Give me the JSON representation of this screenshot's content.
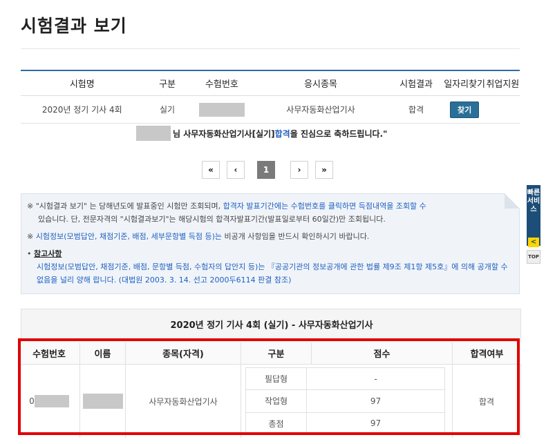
{
  "page": {
    "title": "시험결과 보기"
  },
  "result_table": {
    "headers": [
      "시험명",
      "구분",
      "수험번호",
      "응시종목",
      "시험결과",
      "일자리찾기",
      "취업지원"
    ],
    "row": {
      "exam_name": "2020년 정기 기사 4회",
      "category": "실기",
      "subject": "사무자동화산업기사",
      "result": "합격",
      "find_label": "찾기"
    }
  },
  "congrats": {
    "prefix": "님 사무자동화산업기사[실기] ",
    "highlight": "합격",
    "suffix": "을 진심으로 축하드립니다.\""
  },
  "pager": {
    "first": "«",
    "prev": "‹",
    "current": "1",
    "next": "›",
    "last": "»"
  },
  "notice": {
    "line1_a": "※ \"시험결과 보기\" 는 당해년도에 발표중인 시험만 조회되며, ",
    "line1_b": "합격자 발표기간에는 수험번호를 클릭하면 득점내역을 조회할 수",
    "line1_c": "있습니다. 단, 전문자격의 \"시험결과보기\"는 해당시험의 합격자발표기간(발표일로부터 60일간)만 조회됩니다.",
    "line2_a": "※ ",
    "line2_b": "시험정보(모범답안, 채점기준, 배점, 세부문항별 득점 등)는",
    "line2_c": " 비공개 사항임을 반드시 확인하시기 바랍니다.",
    "ref_title": "참고사항",
    "ref_body": "시험정보(모범답안, 채점기준, 배점, 문항별 득점, 수험자의 답안지 등)는 『공공기관의 정보공개에 관한 법률 제9조 제1항 제5호』에 의해 공개할 수 없음을 널리 양해 랍니다. (대법원 2003. 3. 14. 선고 2000두6114 판결 참조)"
  },
  "quick_menu": {
    "label": "빠른서비스",
    "arrow": "<",
    "top": "TOP"
  },
  "score": {
    "title": "2020년 정기 기사 4회 (실기) - 사무자동화산업기사",
    "headers": [
      "수험번호",
      "이름",
      "종목(자격)",
      "구분",
      "점수",
      "합격여부"
    ],
    "exam_no_prefix": "0",
    "subject": "사무자동화산업기사",
    "rows": [
      {
        "type": "필답형",
        "score": "-"
      },
      {
        "type": "작업형",
        "score": "97"
      },
      {
        "type": "총점",
        "score": "97"
      }
    ],
    "pass": "합격"
  }
}
